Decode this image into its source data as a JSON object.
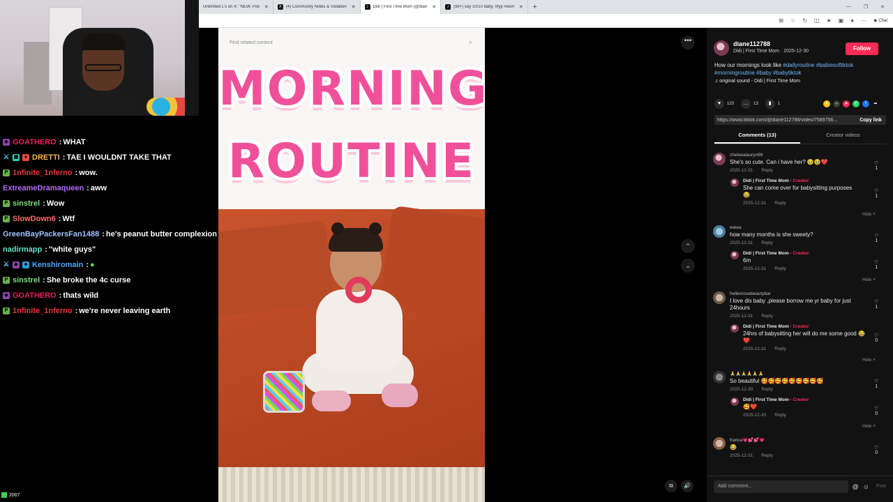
{
  "browser": {
    "tabs": [
      {
        "label": "Unlimited L's on X: \"NEW: Poli",
        "icon": "x-icon"
      },
      {
        "label": "(4) Community Notes & Violation",
        "icon": "x-icon"
      },
      {
        "label": "Didi | First Time Mom (@dian",
        "icon": "tiktok-icon",
        "active": true
      },
      {
        "label": "(99+) say 10/10 baby. #fyp #worl",
        "icon": "tiktok-icon"
      }
    ],
    "chat_button": "Chat"
  },
  "chat": {
    "messages": [
      {
        "user": "GOATHERO",
        "text": "WHAT",
        "color": "#e91e63"
      },
      {
        "user": "DRETTI",
        "text": "TAE I WOULDNT TAKE THAT",
        "color": "#ffb74d"
      },
      {
        "user": "1nfinite_1nferno",
        "text": "wow.",
        "color": "#e53935"
      },
      {
        "user": "ExtreameDramaqueen",
        "text": "aww",
        "color": "#b26bff"
      },
      {
        "user": "sinstrel",
        "text": "Wow",
        "color": "#7be07b"
      },
      {
        "user": "SlowDown6",
        "text": "Wtf",
        "color": "#ff6b6b"
      },
      {
        "user": "GreenBayPackersFan1488",
        "text": "he's peanut butter complexion",
        "color": "#a0c4ff"
      },
      {
        "user": "nadirmapp",
        "text": "\"white guys\"",
        "color": "#5ee6c8"
      },
      {
        "user": "Kenshiromain",
        "text": "",
        "color": "#4aa8ff"
      },
      {
        "user": "sinstrel",
        "text": "She broke the 4c curse",
        "color": "#7be07b"
      },
      {
        "user": "GOATHERO",
        "text": "thats wild",
        "color": "#e91e63"
      },
      {
        "user": "1nfinite_1nferno",
        "text": "we're never leaving earth",
        "color": "#e53935"
      }
    ],
    "viewer_count": "2007"
  },
  "video": {
    "search_placeholder": "Find related content",
    "title_line1": "MORNING",
    "title_line2": "ROUTINE"
  },
  "panel": {
    "author_handle": "diane112788",
    "author_sub": "Didi | First Time Mom · 2025-12-30",
    "follow_label": "Follow",
    "caption_text": "How our mornings look like ",
    "caption_tags": [
      "#dailyroutine",
      "#babiesoftiktok",
      "#morningroutine",
      "#baby",
      "#babytiktok"
    ],
    "sound": "original sound - Didi | First Time Mom",
    "likes": "123",
    "comments_count": "13",
    "saves": "1",
    "link": "https://www.tiktok.com/@diane112788/video/7589756...",
    "copy_link": "Copy link",
    "tab_comments": "Comments (13)",
    "tab_creator": "Creator videos",
    "reply_label": "Reply",
    "hide_label": "Hide",
    "creator_label": "Creator",
    "add_comment_placeholder": "Add comment...",
    "post_label": "Post",
    "comments": [
      {
        "user": "chelsealauryn99",
        "text": "She's so cute. Can i have her? 🥹🥹❤️",
        "date": "2025-12-31",
        "likes": "1",
        "reply": {
          "user": "Didi | First Time Mom",
          "text": "She can come over for babysitting purposes 😂",
          "date": "2025-12-31",
          "likes": "1"
        }
      },
      {
        "user": "wawa",
        "text": "how many months is she sweety?",
        "date": "2025-12-31",
        "likes": "1",
        "reply": {
          "user": "Didi | First Time Mom",
          "text": "6m",
          "date": "2025-12-31",
          "likes": "1"
        }
      },
      {
        "user": "hellenrosebeautybar",
        "text": "I love dis baby ,please borrow me yr baby for just 24hours",
        "date": "2025-12-31",
        "likes": "1",
        "reply": {
          "user": "Didi | First Time Mom",
          "text": "24hrs of babysitting her will do me some good 😂❤️",
          "date": "2025-12-31",
          "likes": "0"
        }
      },
      {
        "user": "🙏🙏🙏🙏🙏🙏",
        "text": "So beautiful 🥰🥰🥰🥰🥰🥰🥰🥰🥰",
        "date": "2025-12-30",
        "likes": "1",
        "reply": {
          "user": "Didi | First Time Mom",
          "text": "🥰❤️",
          "date": "2025-12-30",
          "likes": "0"
        }
      },
      {
        "user": "franca💗💕💕💗",
        "text": "😂",
        "date": "2025-12-31",
        "likes": "0"
      }
    ]
  }
}
